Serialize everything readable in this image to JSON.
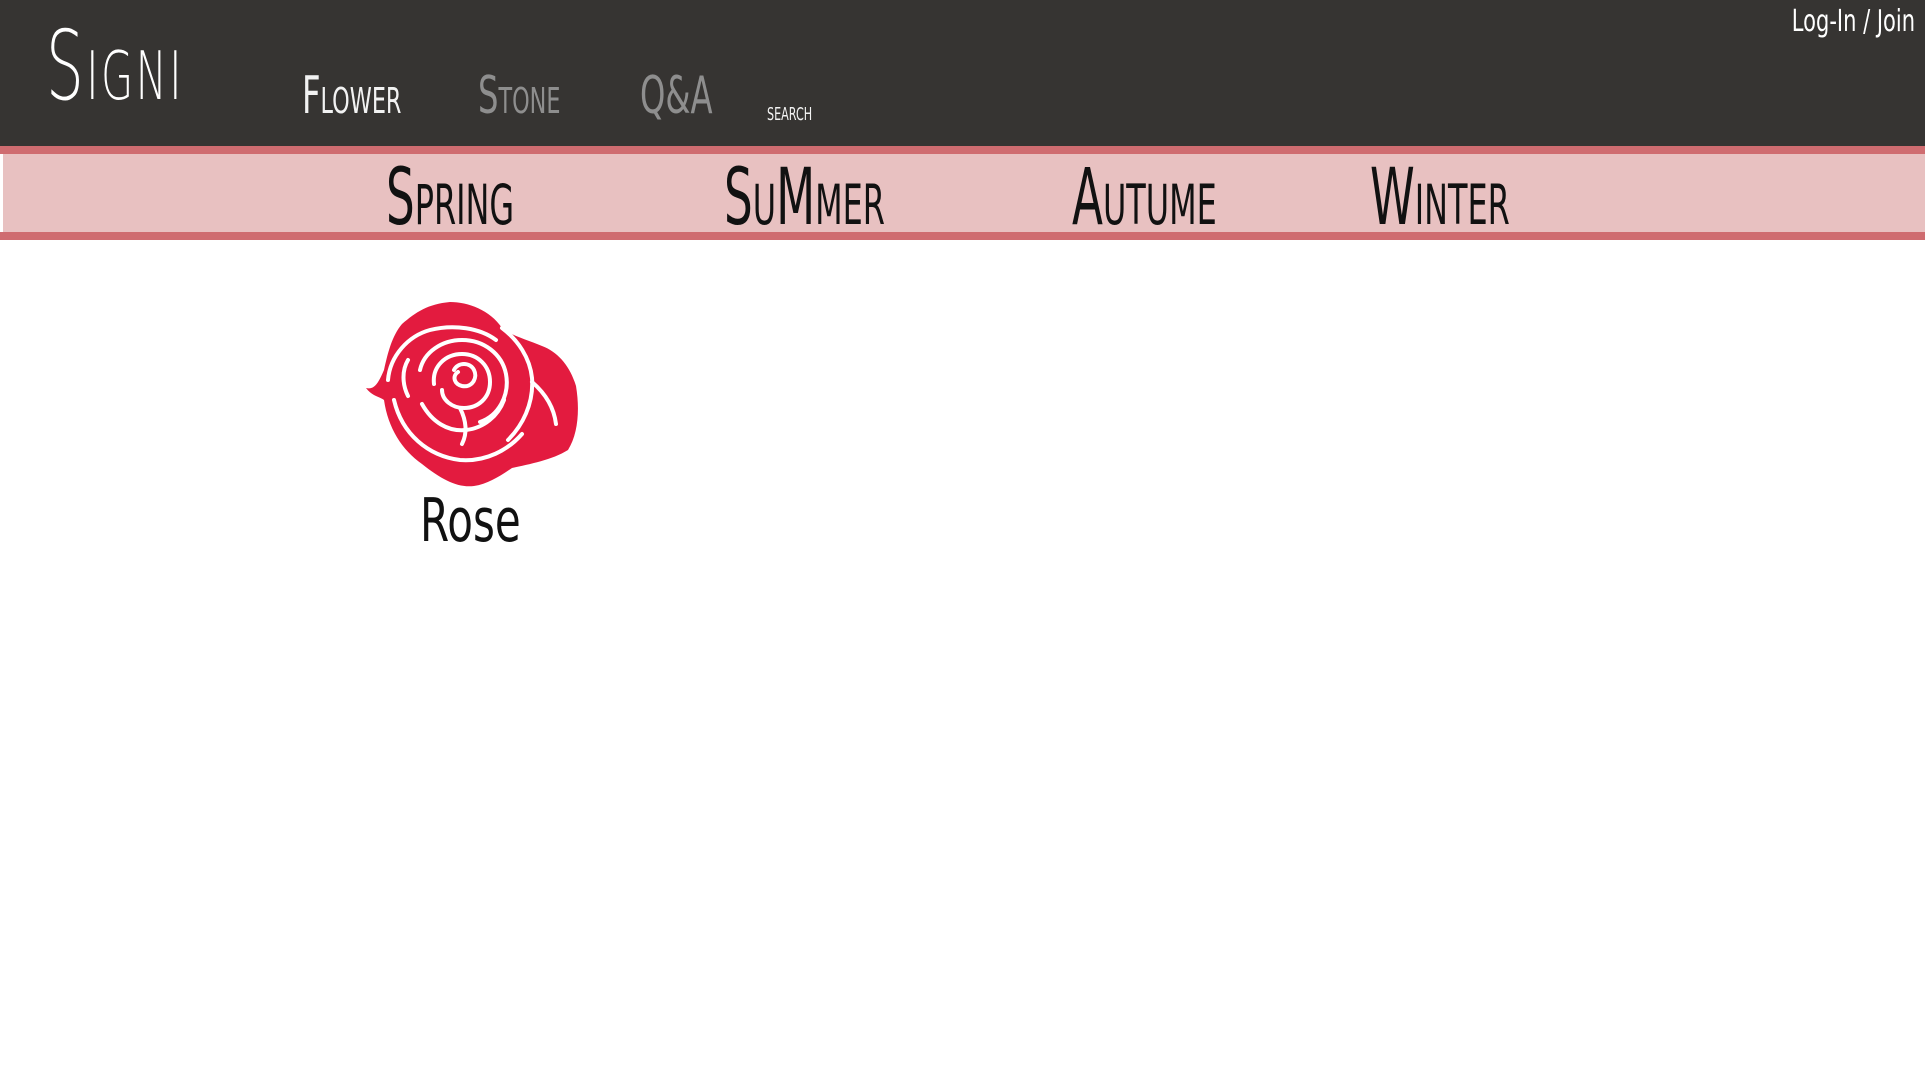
{
  "header": {
    "brand": "Signi",
    "nav": {
      "flower": "Flower",
      "stone": "Stone",
      "qa": "Q&A",
      "search": "search"
    },
    "auth_link": "Log-In / Join"
  },
  "seasons": {
    "spring": "Spring",
    "summer": "SuMmer",
    "autume": "Autume",
    "winter": "Winter"
  },
  "flowers": [
    {
      "name": "Rose",
      "icon": "rose-icon"
    }
  ],
  "colors": {
    "header_bg": "#363432",
    "season_bg": "#e8c1c1",
    "season_border": "#cf6c70",
    "rose": "#e31b3f"
  }
}
